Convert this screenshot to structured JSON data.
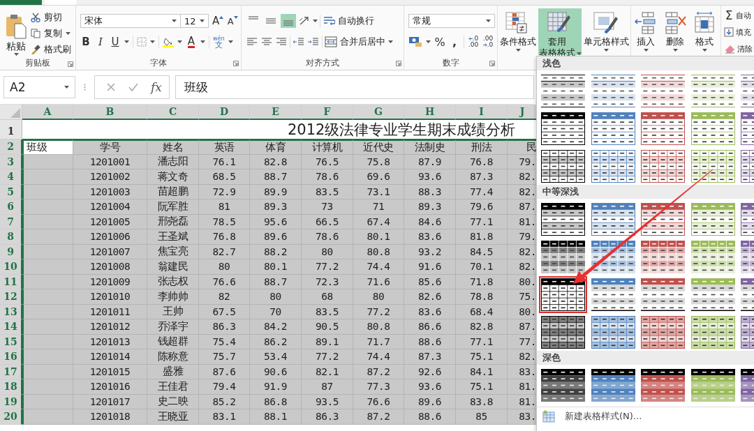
{
  "ribbon": {
    "clipboard": {
      "paste": "粘贴",
      "cut": "剪切",
      "copy": "复制",
      "format_painter": "格式刷",
      "label": "剪贴板"
    },
    "font": {
      "name": "宋体",
      "size": "12",
      "grow": "A",
      "shrink": "A",
      "bold": "B",
      "italic": "I",
      "underline": "U",
      "font_color": "A",
      "phonetic_top": "wén",
      "phonetic": "文",
      "label": "字体"
    },
    "alignment": {
      "vertical": [
        {
          "kind": "top",
          "selected": false
        },
        {
          "kind": "middle",
          "selected": false
        },
        {
          "kind": "bottom",
          "selected": true
        }
      ],
      "wrap": "自动换行",
      "merge": "合并后居中",
      "label": "对齐方式"
    },
    "number": {
      "format": "常规",
      "percent": "%",
      "comma": ",",
      "increase_decimal": [
        ".0",
        ".00"
      ],
      "decrease_decimal": [
        ".00",
        ".0"
      ],
      "label": "数字"
    },
    "styles": [
      {
        "kind": "conditional",
        "lines": [
          "条件格式"
        ],
        "selected": false
      },
      {
        "kind": "table",
        "lines": [
          "套用",
          "表格格式"
        ],
        "selected": true
      },
      {
        "kind": "cell",
        "lines": [
          "单元格样式"
        ],
        "selected": false
      }
    ],
    "cells": [
      {
        "kind": "insert",
        "label": "插入"
      },
      {
        "kind": "delete",
        "label": "删除"
      },
      {
        "kind": "format",
        "label": "格式"
      }
    ],
    "editing": [
      {
        "kind": "sum",
        "symbol": "Σ",
        "label": "自动"
      },
      {
        "kind": "fill",
        "label": "填充"
      },
      {
        "kind": "clear",
        "label": "清除"
      }
    ]
  },
  "formula_bar": {
    "name_box": "A2",
    "function_label": "fx",
    "formula": "班级"
  },
  "sheet": {
    "columns": [
      {
        "label": "A",
        "selected": true
      },
      {
        "label": "B",
        "selected": true
      },
      {
        "label": "C",
        "selected": true
      },
      {
        "label": "D",
        "selected": true
      },
      {
        "label": "E",
        "selected": true
      },
      {
        "label": "F",
        "selected": true
      },
      {
        "label": "G",
        "selected": true
      },
      {
        "label": "H",
        "selected": true
      },
      {
        "label": "I",
        "selected": true
      },
      {
        "label": "J",
        "selected": true
      }
    ],
    "rows": [
      {
        "number": "1",
        "selected": false,
        "title": "2012级法律专业学生期末成绩分析"
      },
      {
        "number": "2",
        "selected": true,
        "active": true,
        "a": "班级",
        "cells": [
          "学号",
          "姓名",
          "英语",
          "体育",
          "计算机",
          "近代史",
          "法制史",
          "刑法",
          "民"
        ]
      },
      {
        "number": "3",
        "selected": true,
        "cells": [
          "1201001",
          "潘志阳",
          "76.1",
          "82.8",
          "76.5",
          "75.8",
          "87.9",
          "76.8",
          "79."
        ]
      },
      {
        "number": "4",
        "selected": true,
        "cells": [
          "1201002",
          "蒋文奇",
          "68.5",
          "88.7",
          "78.6",
          "69.6",
          "93.6",
          "87.3",
          "82."
        ]
      },
      {
        "number": "5",
        "selected": true,
        "cells": [
          "1201003",
          "苗超鹏",
          "72.9",
          "89.9",
          "83.5",
          "73.1",
          "88.3",
          "77.4",
          "82."
        ]
      },
      {
        "number": "6",
        "selected": true,
        "cells": [
          "1201004",
          "阮军胜",
          "81",
          "89.3",
          "73",
          "71",
          "89.3",
          "79.6",
          "87."
        ]
      },
      {
        "number": "7",
        "selected": true,
        "cells": [
          "1201005",
          "邢尧磊",
          "78.5",
          "95.6",
          "66.5",
          "67.4",
          "84.6",
          "77.1",
          "81."
        ]
      },
      {
        "number": "8",
        "selected": true,
        "cells": [
          "1201006",
          "王圣斌",
          "76.8",
          "89.6",
          "78.6",
          "80.1",
          "83.6",
          "81.8",
          "79."
        ]
      },
      {
        "number": "9",
        "selected": true,
        "cells": [
          "1201007",
          "焦宝亮",
          "82.7",
          "88.2",
          "80",
          "80.8",
          "93.2",
          "84.5",
          "82."
        ]
      },
      {
        "number": "10",
        "selected": true,
        "cells": [
          "1201008",
          "翁建民",
          "80",
          "80.1",
          "77.2",
          "74.4",
          "91.6",
          "70.1",
          "82."
        ]
      },
      {
        "number": "11",
        "selected": true,
        "cells": [
          "1201009",
          "张志权",
          "76.6",
          "88.7",
          "72.3",
          "71.6",
          "85.6",
          "71.8",
          "80."
        ]
      },
      {
        "number": "12",
        "selected": true,
        "cells": [
          "1201010",
          "李帅帅",
          "82",
          "80",
          "68",
          "80",
          "82.6",
          "78.8",
          "75."
        ]
      },
      {
        "number": "13",
        "selected": true,
        "cells": [
          "1201011",
          "王帅",
          "67.5",
          "70",
          "83.5",
          "77.2",
          "83.6",
          "68.4",
          "80."
        ]
      },
      {
        "number": "14",
        "selected": true,
        "cells": [
          "1201012",
          "乔泽宇",
          "86.3",
          "84.2",
          "90.5",
          "80.8",
          "86.6",
          "82.8",
          "87."
        ]
      },
      {
        "number": "15",
        "selected": true,
        "cells": [
          "1201013",
          "钱超群",
          "75.4",
          "86.2",
          "89.1",
          "71.7",
          "88.6",
          "77.1",
          "77."
        ]
      },
      {
        "number": "16",
        "selected": true,
        "cells": [
          "1201014",
          "陈称意",
          "75.7",
          "53.4",
          "77.2",
          "74.4",
          "87.3",
          "75.1",
          "82."
        ]
      },
      {
        "number": "17",
        "selected": true,
        "cells": [
          "1201015",
          "盛雅",
          "87.6",
          "90.6",
          "82.1",
          "87.2",
          "92.6",
          "84.1",
          "83."
        ]
      },
      {
        "number": "18",
        "selected": true,
        "cells": [
          "1201016",
          "王佳君",
          "79.4",
          "91.9",
          "87",
          "77.3",
          "93.6",
          "75.1",
          "81."
        ]
      },
      {
        "number": "19",
        "selected": true,
        "cells": [
          "1201017",
          "史二映",
          "85.2",
          "86.8",
          "93.5",
          "76.6",
          "89.6",
          "83.8",
          "81."
        ]
      },
      {
        "number": "20",
        "selected": true,
        "cells": [
          "1201018",
          "王晓亚",
          "83.1",
          "88.1",
          "86.3",
          "87.2",
          "88.6",
          "85",
          "83."
        ]
      }
    ]
  },
  "gallery": {
    "sections": [
      {
        "title": "浅色",
        "rows": [
          [
            {
              "kind": "banded",
              "selected": false
            },
            {
              "kind": "banded",
              "selected": false
            },
            {
              "kind": "banded",
              "selected": false
            },
            {
              "kind": "banded",
              "selected": false
            },
            {
              "kind": "banded",
              "selected": false
            }
          ],
          [
            {
              "kind": "header",
              "selected": false
            },
            {
              "kind": "header",
              "selected": false
            },
            {
              "kind": "header",
              "selected": false
            },
            {
              "kind": "header",
              "selected": false
            },
            {
              "kind": "header",
              "selected": false
            }
          ],
          [
            {
              "kind": "grid",
              "selected": false
            },
            {
              "kind": "grid",
              "selected": false
            },
            {
              "kind": "grid",
              "selected": false
            },
            {
              "kind": "grid",
              "selected": false
            },
            {
              "kind": "grid",
              "selected": false
            }
          ]
        ]
      },
      {
        "title": "中等深浅",
        "rows": [
          [
            {
              "kind": "striped",
              "selected": false
            },
            {
              "kind": "striped",
              "selected": false
            },
            {
              "kind": "striped",
              "selected": false
            },
            {
              "kind": "striped",
              "selected": false
            },
            {
              "kind": "striped",
              "selected": false
            }
          ],
          [
            {
              "kind": "blocks",
              "selected": false
            },
            {
              "kind": "blocks",
              "selected": false
            },
            {
              "kind": "blocks",
              "selected": false
            },
            {
              "kind": "blocks",
              "selected": false
            },
            {
              "kind": "blocks",
              "selected": false
            }
          ],
          [
            {
              "kind": "framed",
              "selected": true
            },
            {
              "kind": "bar",
              "selected": false
            },
            {
              "kind": "bar",
              "selected": false
            },
            {
              "kind": "bar",
              "selected": false
            },
            {
              "kind": "bar",
              "selected": false
            }
          ],
          [
            {
              "kind": "shaded",
              "selected": false
            },
            {
              "kind": "shaded",
              "selected": false
            },
            {
              "kind": "shaded",
              "selected": false
            },
            {
              "kind": "shaded",
              "selected": false
            },
            {
              "kind": "shaded",
              "selected": false
            }
          ]
        ]
      },
      {
        "title": "深色",
        "rows": [
          [
            {
              "kind": "dark",
              "selected": false
            },
            {
              "kind": "dark",
              "selected": false
            },
            {
              "kind": "dark",
              "selected": false
            },
            {
              "kind": "dark",
              "selected": false
            },
            {
              "kind": "dark",
              "selected": false
            }
          ]
        ]
      }
    ],
    "footer": "新建表格样式(N)..."
  }
}
